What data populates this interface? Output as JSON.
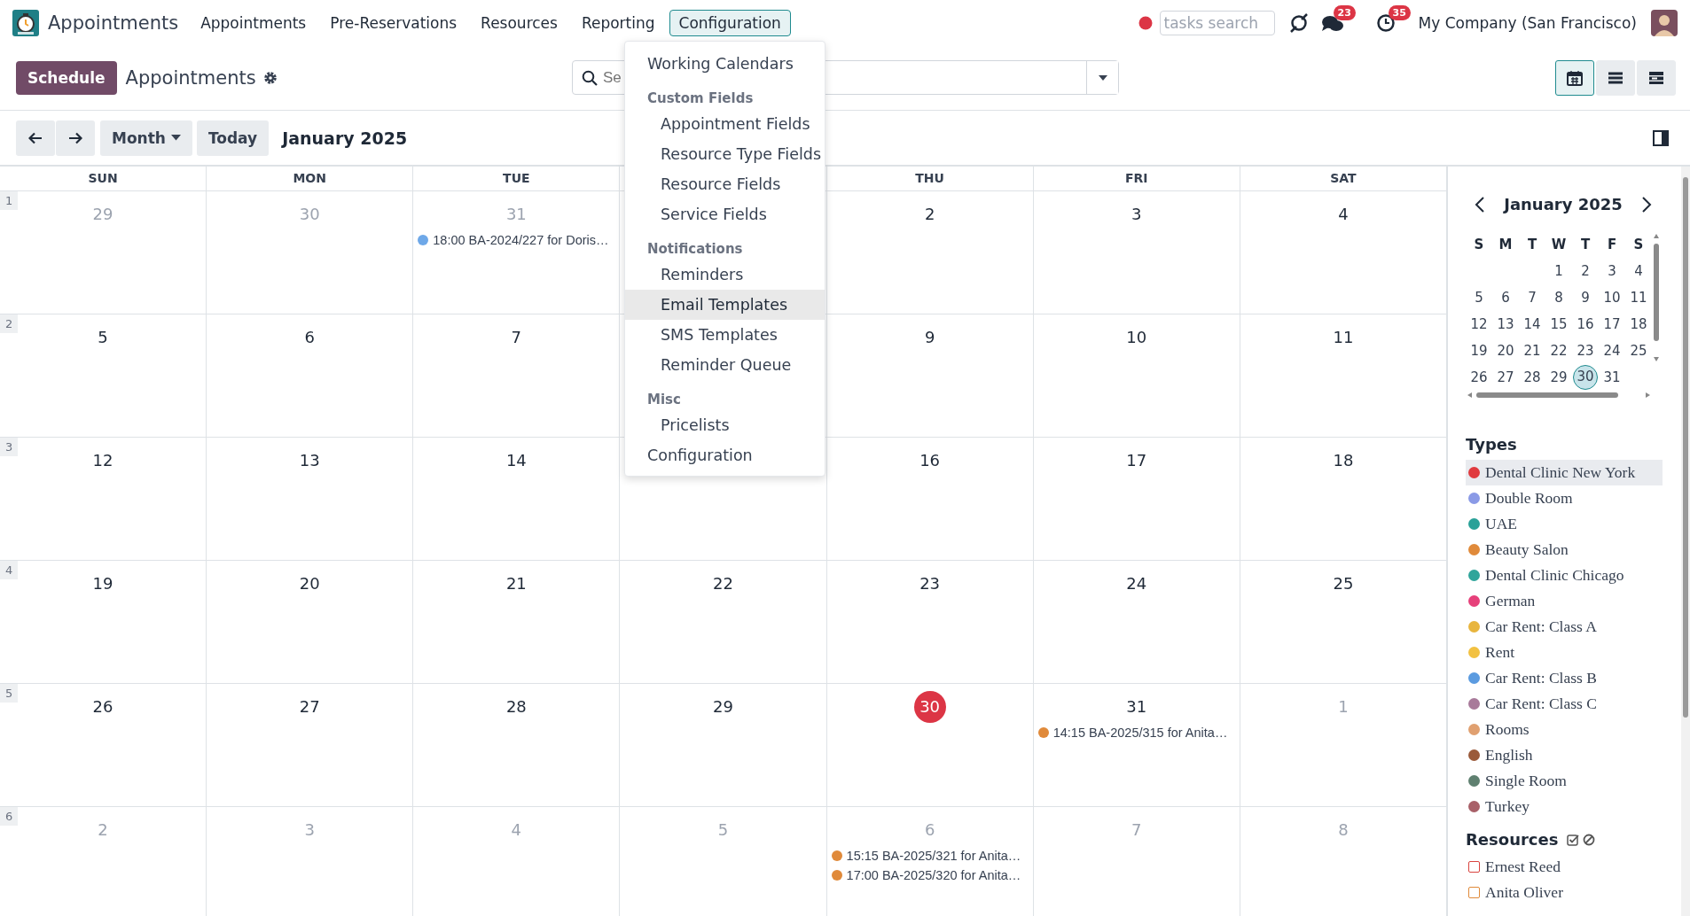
{
  "nav": {
    "app_name": "Appointments",
    "menu": [
      {
        "label": "Appointments",
        "selected": false
      },
      {
        "label": "Pre-Reservations",
        "selected": false
      },
      {
        "label": "Resources",
        "selected": false
      },
      {
        "label": "Reporting",
        "selected": false
      },
      {
        "label": "Configuration",
        "selected": true
      }
    ],
    "tasks_search": {
      "placeholder": "tasks search"
    },
    "messages_badge": "23",
    "activities_badge": "35",
    "company": "My Company (San Francisco)"
  },
  "control_panel": {
    "primary_button": "Schedule",
    "title": "Appointments",
    "search": {
      "placeholder": "Se"
    },
    "views": [
      {
        "kind": "calendar",
        "selected": true
      },
      {
        "kind": "list",
        "selected": false
      },
      {
        "kind": "gantt",
        "selected": false
      }
    ]
  },
  "toolbar": {
    "scale": "Month",
    "today": "Today",
    "period": "January 2025"
  },
  "calendar": {
    "headers": [
      {
        "label": "SUN"
      },
      {
        "label": "MON"
      },
      {
        "label": "TUE"
      },
      {
        "covered": true
      },
      {
        "label": "THU"
      },
      {
        "label": "FRI"
      },
      {
        "label": "SAT"
      }
    ],
    "weeks": [
      {
        "number": "1",
        "days": [
          {
            "date": "29",
            "muted": true,
            "today": false
          },
          {
            "date": "30",
            "muted": true,
            "today": false
          },
          {
            "date": "31",
            "muted": true,
            "today": false,
            "events": [
              {
                "text": "18:00 BA-2024/227 for Doris…",
                "color": "#6ea8e8"
              }
            ]
          },
          {
            "covered": true
          },
          {
            "date": "2",
            "muted": false,
            "today": false
          },
          {
            "date": "3",
            "muted": false,
            "today": false
          },
          {
            "date": "4",
            "muted": false,
            "today": false
          }
        ]
      },
      {
        "number": "2",
        "days": [
          {
            "date": "5",
            "muted": false,
            "today": false
          },
          {
            "date": "6",
            "muted": false,
            "today": false
          },
          {
            "date": "7",
            "muted": false,
            "today": false
          },
          {
            "covered": true
          },
          {
            "date": "9",
            "muted": false,
            "today": false
          },
          {
            "date": "10",
            "muted": false,
            "today": false
          },
          {
            "date": "11",
            "muted": false,
            "today": false
          }
        ]
      },
      {
        "number": "3",
        "days": [
          {
            "date": "12",
            "muted": false,
            "today": false
          },
          {
            "date": "13",
            "muted": false,
            "today": false
          },
          {
            "date": "14",
            "muted": false,
            "today": false
          },
          {
            "covered": true
          },
          {
            "date": "16",
            "muted": false,
            "today": false
          },
          {
            "date": "17",
            "muted": false,
            "today": false
          },
          {
            "date": "18",
            "muted": false,
            "today": false
          }
        ]
      },
      {
        "number": "4",
        "days": [
          {
            "date": "19",
            "muted": false,
            "today": false
          },
          {
            "date": "20",
            "muted": false,
            "today": false
          },
          {
            "date": "21",
            "muted": false,
            "today": false
          },
          {
            "date": "22",
            "muted": false,
            "today": false
          },
          {
            "date": "23",
            "muted": false,
            "today": false
          },
          {
            "date": "24",
            "muted": false,
            "today": false
          },
          {
            "date": "25",
            "muted": false,
            "today": false
          }
        ]
      },
      {
        "number": "5",
        "days": [
          {
            "date": "26",
            "muted": false,
            "today": false
          },
          {
            "date": "27",
            "muted": false,
            "today": false
          },
          {
            "date": "28",
            "muted": false,
            "today": false
          },
          {
            "date": "29",
            "muted": false,
            "today": false
          },
          {
            "date": "30",
            "muted": false,
            "today": true
          },
          {
            "date": "31",
            "muted": false,
            "today": false,
            "events": [
              {
                "text": "14:15 BA-2025/315 for Anita…",
                "color": "#e08a3a"
              }
            ]
          },
          {
            "date": "1",
            "muted": true,
            "today": false
          }
        ]
      },
      {
        "number": "6",
        "days": [
          {
            "date": "2",
            "muted": true,
            "today": false
          },
          {
            "date": "3",
            "muted": true,
            "today": false
          },
          {
            "date": "4",
            "muted": true,
            "today": false
          },
          {
            "date": "5",
            "muted": true,
            "today": false
          },
          {
            "date": "6",
            "muted": true,
            "today": false,
            "events": [
              {
                "text": "15:15 BA-2025/321 for Anita…",
                "color": "#e08a3a"
              },
              {
                "text": "17:00 BA-2025/320 for Anita…",
                "color": "#e08a3a"
              }
            ]
          },
          {
            "date": "7",
            "muted": true,
            "today": false
          },
          {
            "date": "8",
            "muted": true,
            "today": false
          }
        ]
      }
    ]
  },
  "dropdown": {
    "items": [
      {
        "kind": "item",
        "label": "Working Calendars",
        "hovered": false
      },
      {
        "kind": "header",
        "label": "Custom Fields"
      },
      {
        "kind": "subitem",
        "label": "Appointment Fields",
        "hovered": false
      },
      {
        "kind": "subitem",
        "label": "Resource Type Fields",
        "hovered": false
      },
      {
        "kind": "subitem",
        "label": "Resource Fields",
        "hovered": false
      },
      {
        "kind": "subitem",
        "label": "Service Fields",
        "hovered": false
      },
      {
        "kind": "header",
        "label": "Notifications"
      },
      {
        "kind": "subitem",
        "label": "Reminders",
        "hovered": false
      },
      {
        "kind": "subitem",
        "label": "Email Templates",
        "hovered": true
      },
      {
        "kind": "subitem",
        "label": "SMS Templates",
        "hovered": false
      },
      {
        "kind": "subitem",
        "label": "Reminder Queue",
        "hovered": false
      },
      {
        "kind": "header",
        "label": "Misc"
      },
      {
        "kind": "subitem",
        "label": "Pricelists",
        "hovered": false
      },
      {
        "kind": "item",
        "label": "Configuration",
        "hovered": false
      }
    ]
  },
  "sidebar": {
    "mini_calendar": {
      "month": "January 2025",
      "weekdays": [
        "S",
        "M",
        "T",
        "W",
        "T",
        "F",
        "S"
      ],
      "weeks": [
        [
          {
            "day": "1",
            "selected": false
          },
          {
            "day": "2",
            "selected": false
          },
          {
            "day": "3",
            "selected": false
          },
          {
            "day": "4",
            "selected": false
          }
        ],
        [
          {
            "day": "5",
            "selected": false
          },
          {
            "day": "6",
            "selected": false
          },
          {
            "day": "7",
            "selected": false
          },
          {
            "day": "8",
            "selected": false
          },
          {
            "day": "9",
            "selected": false
          },
          {
            "day": "10",
            "selected": false
          },
          {
            "day": "11",
            "selected": false
          }
        ],
        [
          {
            "day": "12",
            "selected": false
          },
          {
            "day": "13",
            "selected": false
          },
          {
            "day": "14",
            "selected": false
          },
          {
            "day": "15",
            "selected": false
          },
          {
            "day": "16",
            "selected": false
          },
          {
            "day": "17",
            "selected": false
          },
          {
            "day": "18",
            "selected": false
          }
        ],
        [
          {
            "day": "19",
            "selected": false
          },
          {
            "day": "20",
            "selected": false
          },
          {
            "day": "21",
            "selected": false
          },
          {
            "day": "22",
            "selected": false
          },
          {
            "day": "23",
            "selected": false
          },
          {
            "day": "24",
            "selected": false
          },
          {
            "day": "25",
            "selected": false
          }
        ],
        [
          {
            "day": "26",
            "selected": false
          },
          {
            "day": "27",
            "selected": false
          },
          {
            "day": "28",
            "selected": false
          },
          {
            "day": "29",
            "selected": false
          },
          {
            "day": "30",
            "selected": true
          },
          {
            "day": "31",
            "selected": false
          }
        ]
      ]
    },
    "types": {
      "title": "Types",
      "items": [
        {
          "label": "Dental Clinic New York",
          "color": "#e03a3e",
          "selected": true
        },
        {
          "label": "Double Room",
          "color": "#8a9ae6",
          "selected": false
        },
        {
          "label": "UAE",
          "color": "#2aa198",
          "selected": false
        },
        {
          "label": "Beauty Salon",
          "color": "#e08a3a",
          "selected": false
        },
        {
          "label": "Dental Clinic Chicago",
          "color": "#30a59b",
          "selected": false
        },
        {
          "label": "German",
          "color": "#e6407a",
          "selected": false
        },
        {
          "label": "Car Rent: Class A",
          "color": "#e8b53e",
          "selected": false
        },
        {
          "label": "Rent",
          "color": "#f2c141",
          "selected": false
        },
        {
          "label": "Car Rent: Class B",
          "color": "#5b9be0",
          "selected": false
        },
        {
          "label": "Car Rent: Class C",
          "color": "#a87a9a",
          "selected": false
        },
        {
          "label": "Rooms",
          "color": "#e0a070",
          "selected": false
        },
        {
          "label": "English",
          "color": "#9a5a3a",
          "selected": false
        },
        {
          "label": "Single Room",
          "color": "#5f8070",
          "selected": false
        },
        {
          "label": "Turkey",
          "color": "#a86068",
          "selected": false
        }
      ]
    },
    "resources": {
      "title": "Resources",
      "items": [
        {
          "label": "Ernest Reed",
          "color": "#d9443f",
          "checked": false
        },
        {
          "label": "Anita Oliver",
          "color": "#e08a3a",
          "checked": false
        }
      ]
    }
  }
}
